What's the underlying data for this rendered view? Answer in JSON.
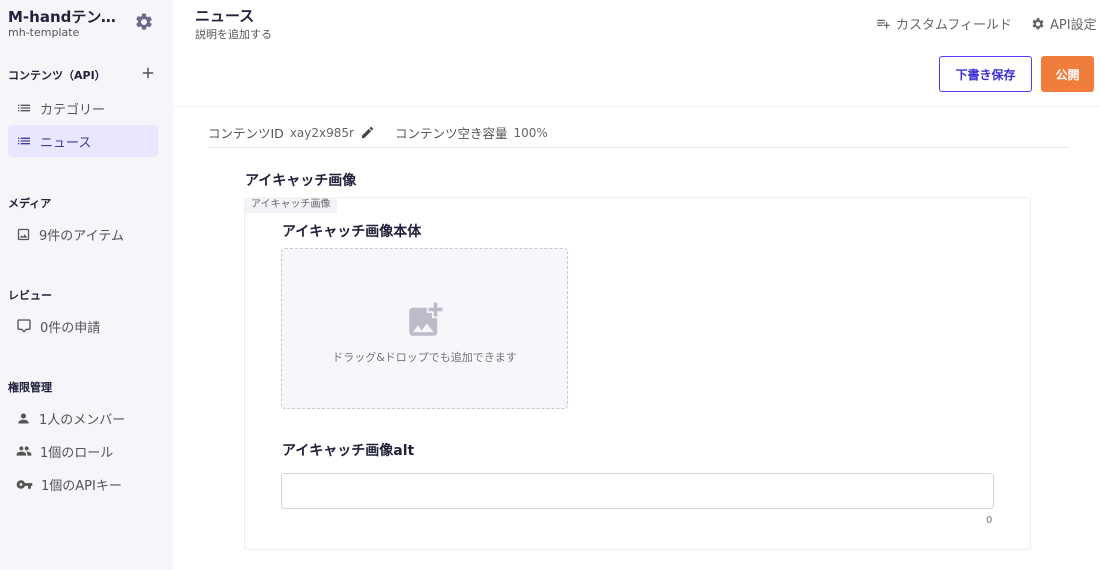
{
  "workspace": {
    "name": "M-handテンプ...",
    "slug": "mh-template"
  },
  "sidebar": {
    "contents_section": "コンテンツ（API）",
    "contents_items": [
      {
        "label": "カテゴリー",
        "icon": "list-icon"
      },
      {
        "label": "ニュース",
        "icon": "list-icon",
        "active": true
      }
    ],
    "media_section": "メディア",
    "media_item": "9件のアイテム",
    "review_section": "レビュー",
    "review_item": "0件の申請",
    "permission_section": "権限管理",
    "permission_items": [
      {
        "label": "1人のメンバー",
        "icon": "person-icon"
      },
      {
        "label": "1個のロール",
        "icon": "group-icon"
      },
      {
        "label": "1個のAPIキー",
        "icon": "key-icon"
      }
    ]
  },
  "header": {
    "title": "ニュース",
    "description": "説明を追加する",
    "custom_fields_label": "カスタムフィールド",
    "api_settings_label": "API設定",
    "draft_button": "下書き保存",
    "publish_button": "公開"
  },
  "meta": {
    "content_id_label": "コンテンツID",
    "content_id_value": "xay2x985r",
    "capacity_label": "コンテンツ空き容量",
    "capacity_value": "100%"
  },
  "form": {
    "group_title": "アイキャッチ画像",
    "group_tag": "アイキャッチ画像",
    "image_field_title": "アイキャッチ画像本体",
    "dropzone_text": "ドラッグ&ドロップでも追加できます",
    "alt_field_title": "アイキャッチ画像alt",
    "alt_value": "",
    "alt_counter": "0"
  },
  "colors": {
    "accent": "#563bff",
    "publish": "#f07d3b",
    "sidebar_bg": "#f5f5fa",
    "active_bg": "#e9e6ff"
  }
}
